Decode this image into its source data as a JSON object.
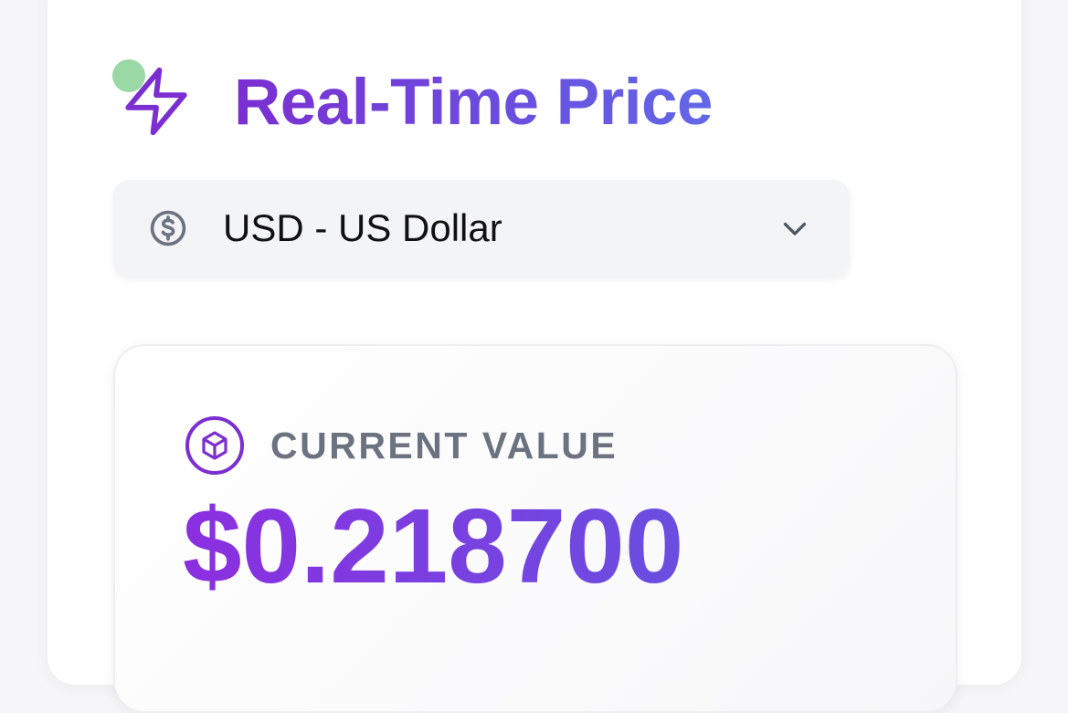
{
  "header": {
    "title": "Real-Time Price",
    "status_color": "#9ad8a6",
    "icon": "lightning-bolt-icon"
  },
  "currency_select": {
    "selected": "USD - US Dollar",
    "icon": "dollar-circle-icon",
    "chevron": "chevron-down-icon"
  },
  "value_card": {
    "label": "CURRENT VALUE",
    "amount": "$0.218700",
    "icon": "cube-icon"
  },
  "colors": {
    "accent_purple": "#7b2fd1",
    "accent_indigo": "#6268e6",
    "label_gray": "#6b7280"
  }
}
